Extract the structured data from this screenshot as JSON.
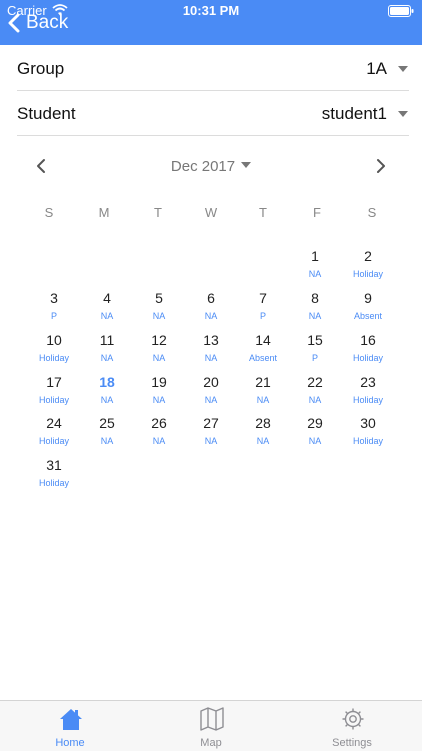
{
  "status": {
    "carrier": "Carrier",
    "time": "10:31 PM"
  },
  "header": {
    "back_label": "Back"
  },
  "filters": [
    {
      "label": "Group",
      "value": "1A"
    },
    {
      "label": "Student",
      "value": "student1"
    }
  ],
  "calendar": {
    "month": "Dec 2017",
    "weekdays": [
      "S",
      "M",
      "T",
      "W",
      "T",
      "F",
      "S"
    ],
    "today": "18",
    "days": [
      {
        "day": "1",
        "status": "NA"
      },
      {
        "day": "2",
        "status": "Holiday"
      },
      {
        "day": "3",
        "status": "P"
      },
      {
        "day": "4",
        "status": "NA"
      },
      {
        "day": "5",
        "status": "NA"
      },
      {
        "day": "6",
        "status": "NA"
      },
      {
        "day": "7",
        "status": "P"
      },
      {
        "day": "8",
        "status": "NA"
      },
      {
        "day": "9",
        "status": "Absent"
      },
      {
        "day": "10",
        "status": "Holiday"
      },
      {
        "day": "11",
        "status": "NA"
      },
      {
        "day": "12",
        "status": "NA"
      },
      {
        "day": "13",
        "status": "NA"
      },
      {
        "day": "14",
        "status": "Absent"
      },
      {
        "day": "15",
        "status": "P"
      },
      {
        "day": "16",
        "status": "Holiday"
      },
      {
        "day": "17",
        "status": "Holiday"
      },
      {
        "day": "18",
        "status": "NA"
      },
      {
        "day": "19",
        "status": "NA"
      },
      {
        "day": "20",
        "status": "NA"
      },
      {
        "day": "21",
        "status": "NA"
      },
      {
        "day": "22",
        "status": "NA"
      },
      {
        "day": "23",
        "status": "Holiday"
      },
      {
        "day": "24",
        "status": "Holiday"
      },
      {
        "day": "25",
        "status": "NA"
      },
      {
        "day": "26",
        "status": "NA"
      },
      {
        "day": "27",
        "status": "NA"
      },
      {
        "day": "28",
        "status": "NA"
      },
      {
        "day": "29",
        "status": "NA"
      },
      {
        "day": "30",
        "status": "Holiday"
      },
      {
        "day": "31",
        "status": "Holiday"
      }
    ]
  },
  "tabs": [
    {
      "label": "Home",
      "icon": "home-icon"
    },
    {
      "label": "Map",
      "icon": "map-icon"
    },
    {
      "label": "Settings",
      "icon": "gear-icon"
    }
  ],
  "colors": {
    "accent": "#4a8bf5",
    "inactive": "#8e8e93"
  }
}
